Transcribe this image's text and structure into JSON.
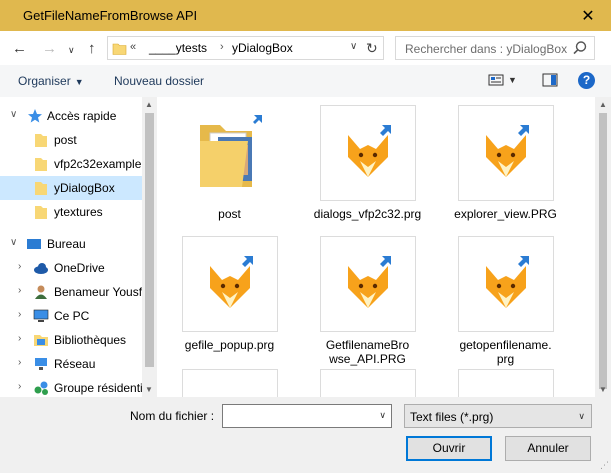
{
  "window": {
    "title": "GetFileNameFromBrowse API"
  },
  "nav": {
    "address_prefix": "«",
    "crumbs": [
      "____ytests",
      "yDialogBox"
    ],
    "search_placeholder": "Rechercher dans : yDialogBox"
  },
  "toolbar": {
    "organize": "Organiser",
    "new_folder": "Nouveau dossier",
    "help": "?"
  },
  "sidebar": {
    "items": [
      {
        "label": "Accès rapide",
        "icon": "star-icon"
      },
      {
        "label": "post",
        "icon": "folder-pin-icon"
      },
      {
        "label": "vfp2c32example",
        "icon": "folder-pin-icon"
      },
      {
        "label": "yDialogBox",
        "icon": "folder-pin-icon"
      },
      {
        "label": "ytextures",
        "icon": "folder-pin-icon"
      },
      {
        "label": "Bureau",
        "icon": "desktop-icon"
      },
      {
        "label": "OneDrive",
        "icon": "cloud-icon"
      },
      {
        "label": "Benameur Yousf",
        "icon": "user-icon"
      },
      {
        "label": "Ce PC",
        "icon": "computer-icon"
      },
      {
        "label": "Bibliothèques",
        "icon": "library-icon"
      },
      {
        "label": "Réseau",
        "icon": "network-icon"
      },
      {
        "label": "Groupe résidenti",
        "icon": "homegroup-icon"
      }
    ]
  },
  "files": [
    {
      "name": "post",
      "type": "folder"
    },
    {
      "name": "dialogs_vfp2c32.prg",
      "type": "prg"
    },
    {
      "name": "explorer_view.PRG",
      "type": "prg"
    },
    {
      "name": "gefile_popup.prg",
      "type": "prg"
    },
    {
      "name": "GetfilenameBrowse_API.PRG",
      "type": "prg"
    },
    {
      "name": "getopenfilename.prg",
      "type": "prg"
    }
  ],
  "bottom": {
    "filename_label": "Nom du fichier :",
    "filename_value": "",
    "filetype_value": "Text files (*.prg)",
    "open_button": "Ouvrir",
    "cancel_button": "Annuler"
  },
  "colors": {
    "titlebar": "#e0b84e",
    "selected": "#cce8ff",
    "primary_border": "#0078d7",
    "link": "#1e395b"
  }
}
